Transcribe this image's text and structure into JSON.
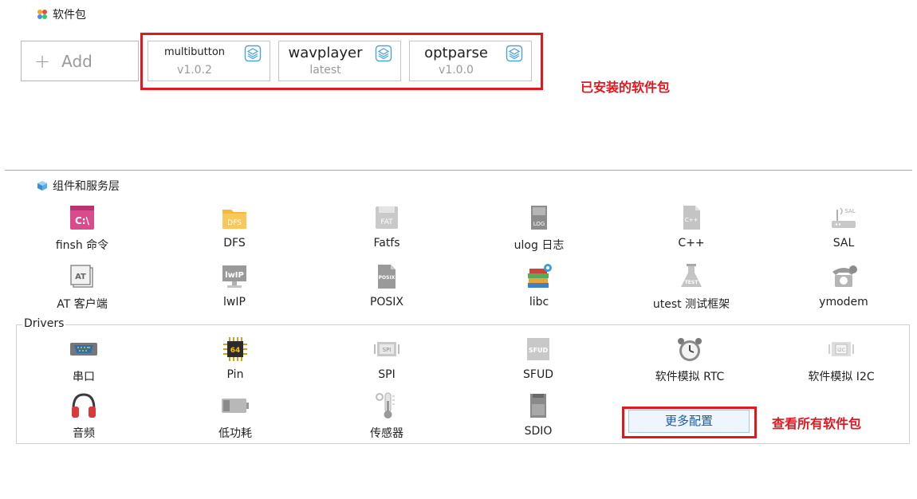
{
  "software_packages": {
    "title": "软件包",
    "add_label": "Add",
    "items": [
      {
        "name": "multibutton",
        "version": "v1.0.2"
      },
      {
        "name": "wavplayer",
        "version": "latest"
      },
      {
        "name": "optparse",
        "version": "v1.0.0"
      }
    ],
    "annotation": "已安装的软件包"
  },
  "components": {
    "title": "组件和服务层",
    "items": [
      {
        "label": "finsh 命令",
        "icon": "terminal-icon"
      },
      {
        "label": "DFS",
        "icon": "folder-icon"
      },
      {
        "label": "Fatfs",
        "icon": "fat-disk-icon"
      },
      {
        "label": "ulog 日志",
        "icon": "log-file-icon"
      },
      {
        "label": "C++",
        "icon": "cpp-file-icon"
      },
      {
        "label": "SAL",
        "icon": "router-icon"
      },
      {
        "label": "AT 客户端",
        "icon": "at-icon"
      },
      {
        "label": "lwIP",
        "icon": "lwip-monitor-icon"
      },
      {
        "label": "POSIX",
        "icon": "posix-file-icon"
      },
      {
        "label": "libc",
        "icon": "books-icon"
      },
      {
        "label": "utest 测试框架",
        "icon": "test-flask-icon"
      },
      {
        "label": "ymodem",
        "icon": "telephone-icon"
      }
    ]
  },
  "drivers": {
    "title": "Drivers",
    "items": [
      {
        "label": "串口",
        "icon": "serial-port-icon"
      },
      {
        "label": "Pin",
        "icon": "chip-icon"
      },
      {
        "label": "SPI",
        "icon": "spi-icon"
      },
      {
        "label": "SFUD",
        "icon": "sfud-chip-icon"
      },
      {
        "label": "软件模拟 RTC",
        "icon": "alarm-clock-icon"
      },
      {
        "label": "软件模拟 I2C",
        "icon": "i2c-icon"
      },
      {
        "label": "音频",
        "icon": "headphones-icon"
      },
      {
        "label": "低功耗",
        "icon": "battery-icon"
      },
      {
        "label": "传感器",
        "icon": "thermometer-icon"
      },
      {
        "label": "SDIO",
        "icon": "sd-card-icon"
      }
    ],
    "more_button": "更多配置",
    "annotation": "查看所有软件包"
  },
  "colors": {
    "annotation_red": "#e01820",
    "link_blue": "#1a5aa8",
    "package_icon_blue": "#4aa3e0"
  }
}
